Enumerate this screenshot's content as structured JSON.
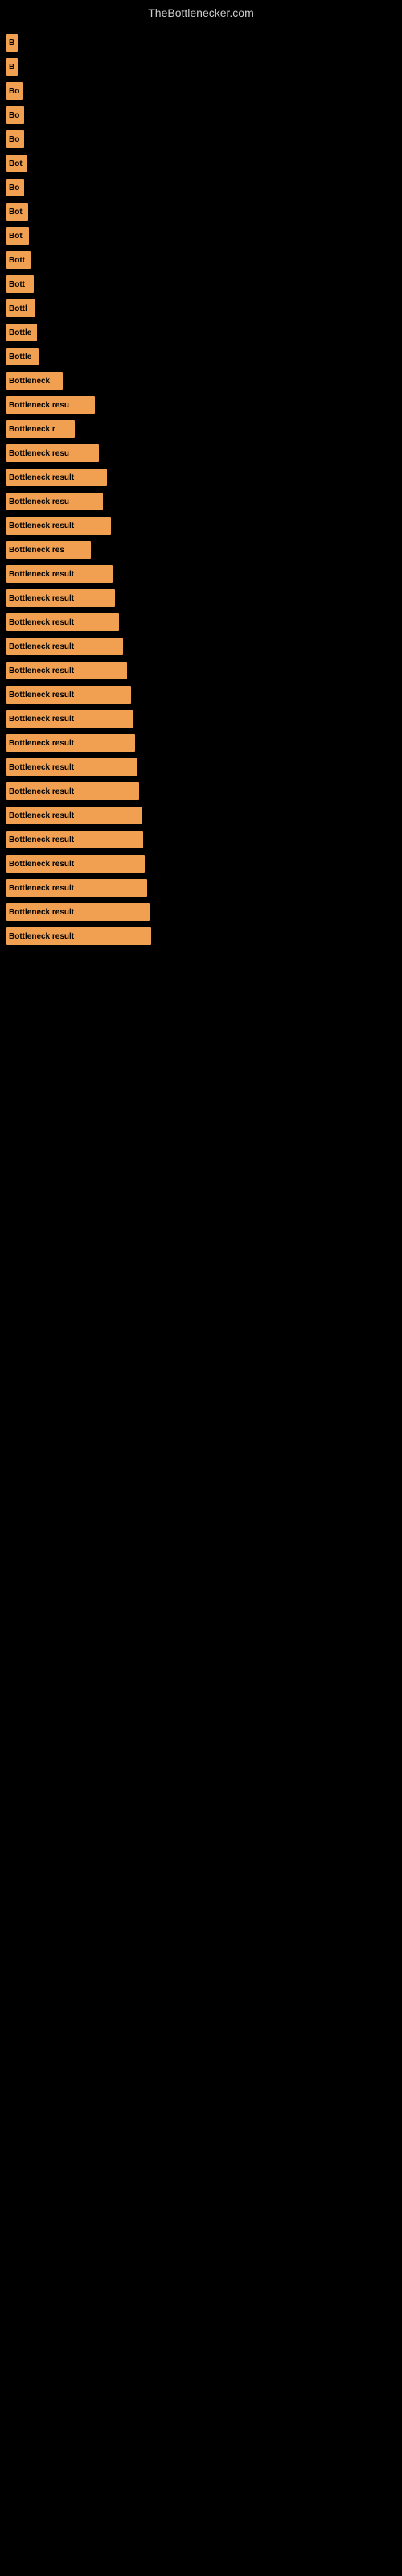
{
  "site": {
    "title": "TheBottlenecker.com"
  },
  "bars": [
    {
      "label": "B",
      "width": 14
    },
    {
      "label": "B",
      "width": 14
    },
    {
      "label": "Bo",
      "width": 20
    },
    {
      "label": "Bo",
      "width": 22
    },
    {
      "label": "Bo",
      "width": 22
    },
    {
      "label": "Bot",
      "width": 26
    },
    {
      "label": "Bo",
      "width": 22
    },
    {
      "label": "Bot",
      "width": 27
    },
    {
      "label": "Bot",
      "width": 28
    },
    {
      "label": "Bott",
      "width": 30
    },
    {
      "label": "Bott",
      "width": 34
    },
    {
      "label": "Bottl",
      "width": 36
    },
    {
      "label": "Bottle",
      "width": 38
    },
    {
      "label": "Bottle",
      "width": 40
    },
    {
      "label": "Bottleneck",
      "width": 70
    },
    {
      "label": "Bottleneck resu",
      "width": 110
    },
    {
      "label": "Bottleneck r",
      "width": 85
    },
    {
      "label": "Bottleneck resu",
      "width": 115
    },
    {
      "label": "Bottleneck result",
      "width": 125
    },
    {
      "label": "Bottleneck resu",
      "width": 120
    },
    {
      "label": "Bottleneck result",
      "width": 130
    },
    {
      "label": "Bottleneck res",
      "width": 105
    },
    {
      "label": "Bottleneck result",
      "width": 132
    },
    {
      "label": "Bottleneck result",
      "width": 135
    },
    {
      "label": "Bottleneck result",
      "width": 140
    },
    {
      "label": "Bottleneck result",
      "width": 145
    },
    {
      "label": "Bottleneck result",
      "width": 150
    },
    {
      "label": "Bottleneck result",
      "width": 155
    },
    {
      "label": "Bottleneck result",
      "width": 158
    },
    {
      "label": "Bottleneck result",
      "width": 160
    },
    {
      "label": "Bottleneck result",
      "width": 163
    },
    {
      "label": "Bottleneck result",
      "width": 165
    },
    {
      "label": "Bottleneck result",
      "width": 168
    },
    {
      "label": "Bottleneck result",
      "width": 170
    },
    {
      "label": "Bottleneck result",
      "width": 172
    },
    {
      "label": "Bottleneck result",
      "width": 175
    },
    {
      "label": "Bottleneck result",
      "width": 178
    },
    {
      "label": "Bottleneck result",
      "width": 180
    }
  ]
}
